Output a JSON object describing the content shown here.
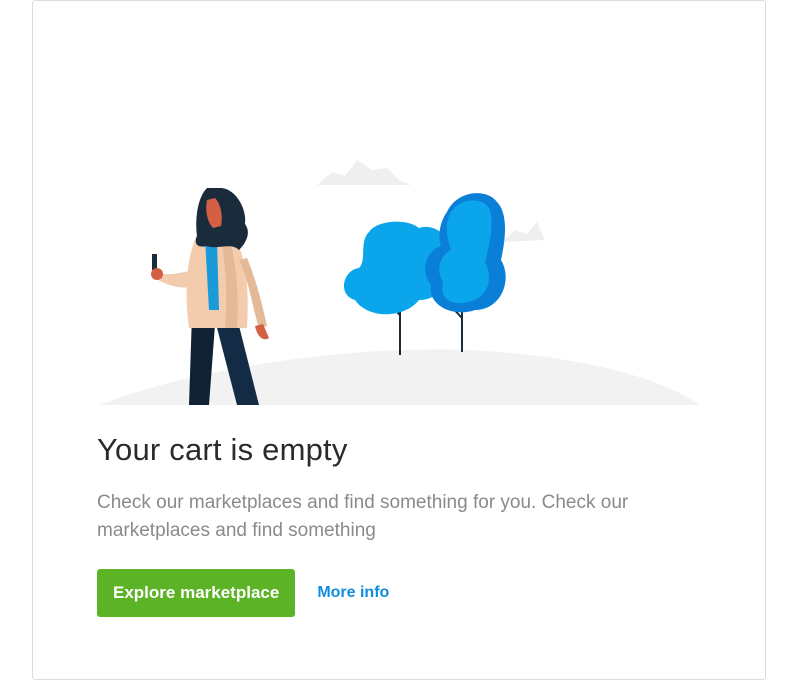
{
  "empty_state": {
    "title": "Your cart is empty",
    "description": "Check our marketplaces and find something for you. Check our marketplaces and find something",
    "primary_action_label": "Explore marketplace",
    "secondary_action_label": "More info",
    "illustration": "woman-with-phone-walking-past-trees"
  },
  "colors": {
    "primary_button": "#5bb325",
    "link": "#0f8ee0",
    "tree_light": "#0ba5ec",
    "tree_dark": "#0a7fd8"
  }
}
